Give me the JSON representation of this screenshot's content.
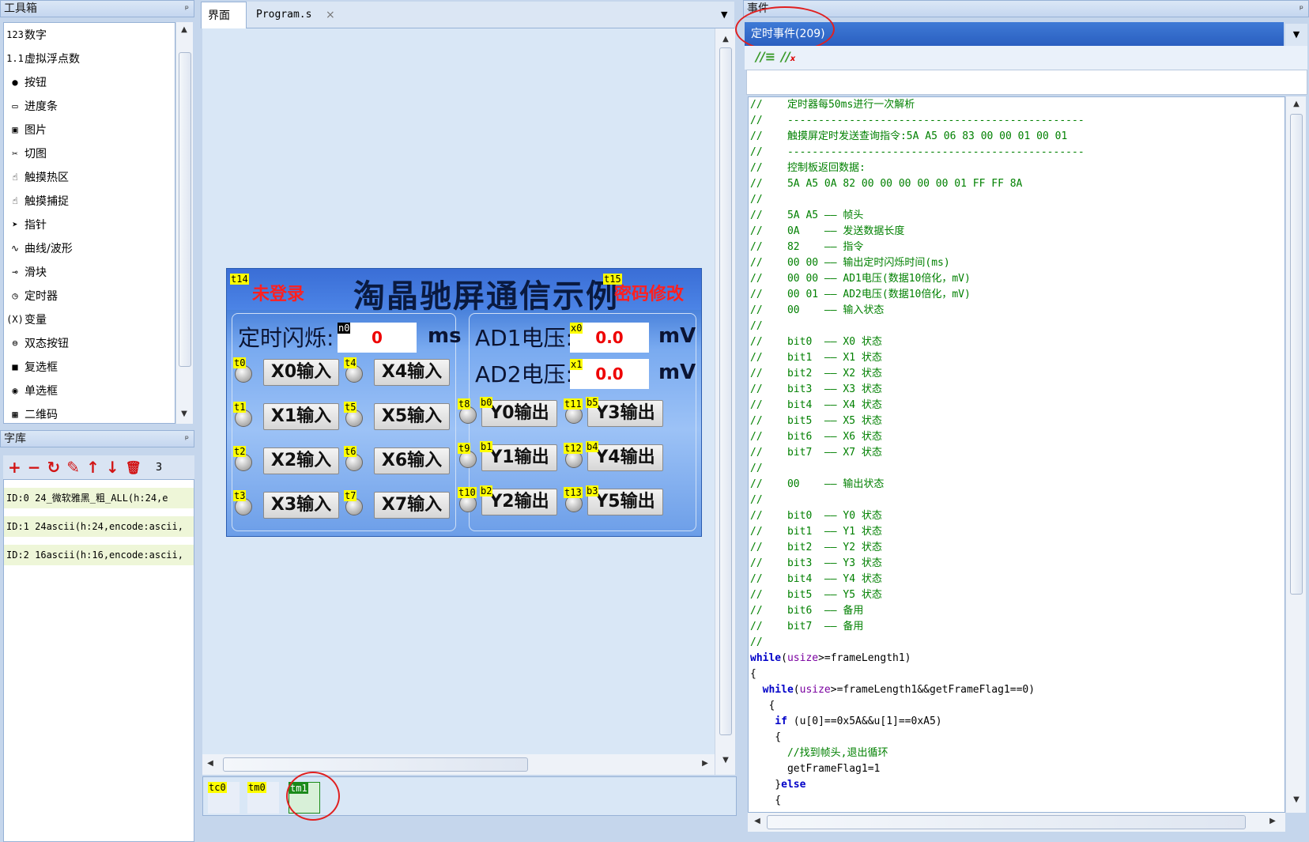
{
  "toolbox": {
    "title": "工具箱",
    "pin": "ᵖ",
    "items": [
      {
        "icon": "123",
        "label": "数字"
      },
      {
        "icon": "1.1",
        "label": "虚拟浮点数"
      },
      {
        "icon": "●",
        "label": "按钮"
      },
      {
        "icon": "▭",
        "label": "进度条"
      },
      {
        "icon": "▣",
        "label": "图片"
      },
      {
        "icon": "✂",
        "label": "切图"
      },
      {
        "icon": "☝",
        "label": "触摸热区"
      },
      {
        "icon": "☝",
        "label": "触摸捕捉"
      },
      {
        "icon": "➤",
        "label": "指针"
      },
      {
        "icon": "∿",
        "label": "曲线/波形"
      },
      {
        "icon": "⊸",
        "label": "滑块"
      },
      {
        "icon": "◷",
        "label": "定时器"
      },
      {
        "icon": "(X)",
        "label": "变量"
      },
      {
        "icon": "⊜",
        "label": "双态按钮"
      },
      {
        "icon": "■",
        "label": "复选框"
      },
      {
        "icon": "◉",
        "label": "单选框"
      },
      {
        "icon": "▦",
        "label": "二维码"
      }
    ]
  },
  "fontlib": {
    "title": "字库",
    "count": "3",
    "tools": [
      "+",
      "−",
      "↻",
      "✎",
      "↑",
      "↓",
      "🗑"
    ],
    "rows": [
      "ID:0   24_微软雅黑_粗_ALL(h:24,e",
      "ID:1   24ascii(h:24,encode:ascii,",
      "ID:2   16ascii(h:16,encode:ascii,"
    ]
  },
  "tabs": {
    "tab1": "界面",
    "tab2": "Program.s",
    "close": "×",
    "dropdown": "▼"
  },
  "screen": {
    "title": "淘晶驰屏通信示例",
    "not_logged": "未登录",
    "pwd_change": "密码修改",
    "t14": "t14",
    "t15": "t15",
    "blink_label": "定时闪烁:",
    "n0": "n0",
    "blink_value": "0",
    "ms": "ms",
    "ad1_label": "AD1电压:",
    "ad2_label": "AD2电压:",
    "x0": "x0",
    "x1": "x1",
    "ad1_value": "0.0",
    "ad2_value": "0.0",
    "mv1": "mV",
    "mv2": "mV",
    "inputs": [
      {
        "tag": "t0",
        "label": "X0输入"
      },
      {
        "tag": "t1",
        "label": "X1输入"
      },
      {
        "tag": "t2",
        "label": "X2输入"
      },
      {
        "tag": "t3",
        "label": "X3输入"
      },
      {
        "tag": "t4",
        "label": "X4输入"
      },
      {
        "tag": "t5",
        "label": "X5输入"
      },
      {
        "tag": "t6",
        "label": "X6输入"
      },
      {
        "tag": "t7",
        "label": "X7输入"
      }
    ],
    "outputs": [
      {
        "led": "t8",
        "tag": "b0",
        "label": "Y0输出"
      },
      {
        "led": "t9",
        "tag": "b1",
        "label": "Y1输出"
      },
      {
        "led": "t10",
        "tag": "b2",
        "label": "Y2输出"
      },
      {
        "led": "t11",
        "tag": "b5",
        "label": "Y3输出"
      },
      {
        "led": "t12",
        "tag": "b4",
        "label": "Y4输出"
      },
      {
        "led": "t13",
        "tag": "b3",
        "label": "Y5输出"
      }
    ]
  },
  "timers": [
    "tc0",
    "tm0",
    "tm1"
  ],
  "events": {
    "title": "事件",
    "pin": "ᵖ",
    "selected": "定时事件(209)",
    "dropdown": "▼"
  },
  "code": [
    "//    定时器每50ms进行一次解析",
    "//    ------------------------------------------------",
    "//    触摸屏定时发送查询指令:5A A5 06 83 00 00 01 00 01",
    "//    ------------------------------------------------",
    "//    控制板返回数据:",
    "//    5A A5 0A 82 00 00 00 00 00 01 FF FF 8A",
    "//",
    "//    5A A5 —— 帧头",
    "//    0A    —— 发送数据长度",
    "//    82    —— 指令",
    "//    00 00 —— 输出定时闪烁时间(ms)",
    "//    00 00 —— AD1电压(数据10倍化，mV)",
    "//    00 01 —— AD2电压(数据10倍化，mV)",
    "//    00    —— 输入状态",
    "//",
    "//    bit0  —— X0 状态",
    "//    bit1  —— X1 状态",
    "//    bit2  —— X2 状态",
    "//    bit3  —— X3 状态",
    "//    bit4  —— X4 状态",
    "//    bit5  —— X5 状态",
    "//    bit6  —— X6 状态",
    "//    bit7  —— X7 状态",
    "//",
    "//    00    —— 输出状态",
    "//",
    "//    bit0  —— Y0 状态",
    "//    bit1  —— Y1 状态",
    "//    bit2  —— Y2 状态",
    "//    bit3  —— Y3 状态",
    "//    bit4  —— Y4 状态",
    "//    bit5  —— Y5 状态",
    "//    bit6  —— 备用",
    "//    bit7  —— 备用",
    "//"
  ],
  "code2": {
    "l1a": "while",
    "l1b": "(",
    "l1c": "usize",
    "l1d": ">=frameLength1)",
    "l2": "{",
    "l3a": "  while",
    "l3b": "(",
    "l3c": "usize",
    "l3d": ">=frameLength1&&getFrameFlag1==0)",
    "l4": "   {",
    "l5a": "    if",
    "l5b": " (u[0]==0x5A&&u[1]==0xA5)",
    "l6": "    {",
    "l7": "      //找到帧头,退出循环",
    "l8": "      getFrameFlag1=1",
    "l9a": "    }",
    "l9b": "else",
    "l10": "    {"
  }
}
